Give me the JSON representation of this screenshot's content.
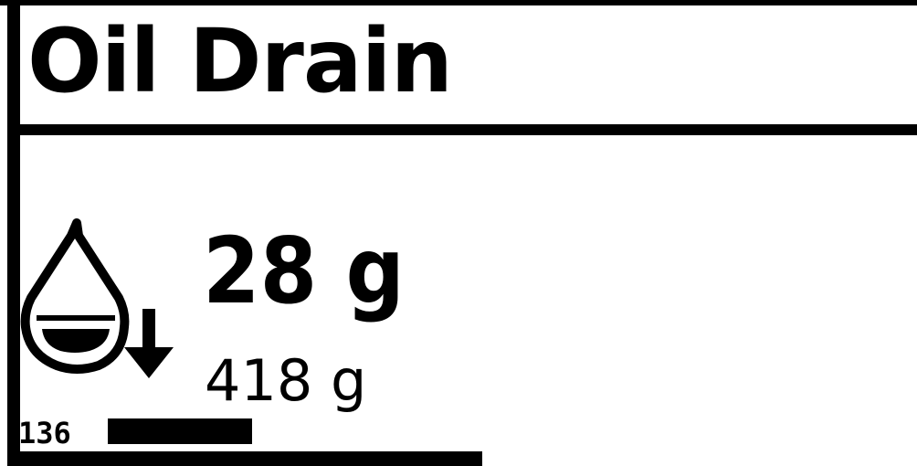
{
  "screen": {
    "title": "Oil Drain",
    "icon": "oil-drop-drain-icon",
    "main_value": "28 g",
    "sub_value": "418 g",
    "status_number": "136",
    "colors": {
      "foreground": "#000000",
      "background": "#ffffff"
    }
  }
}
